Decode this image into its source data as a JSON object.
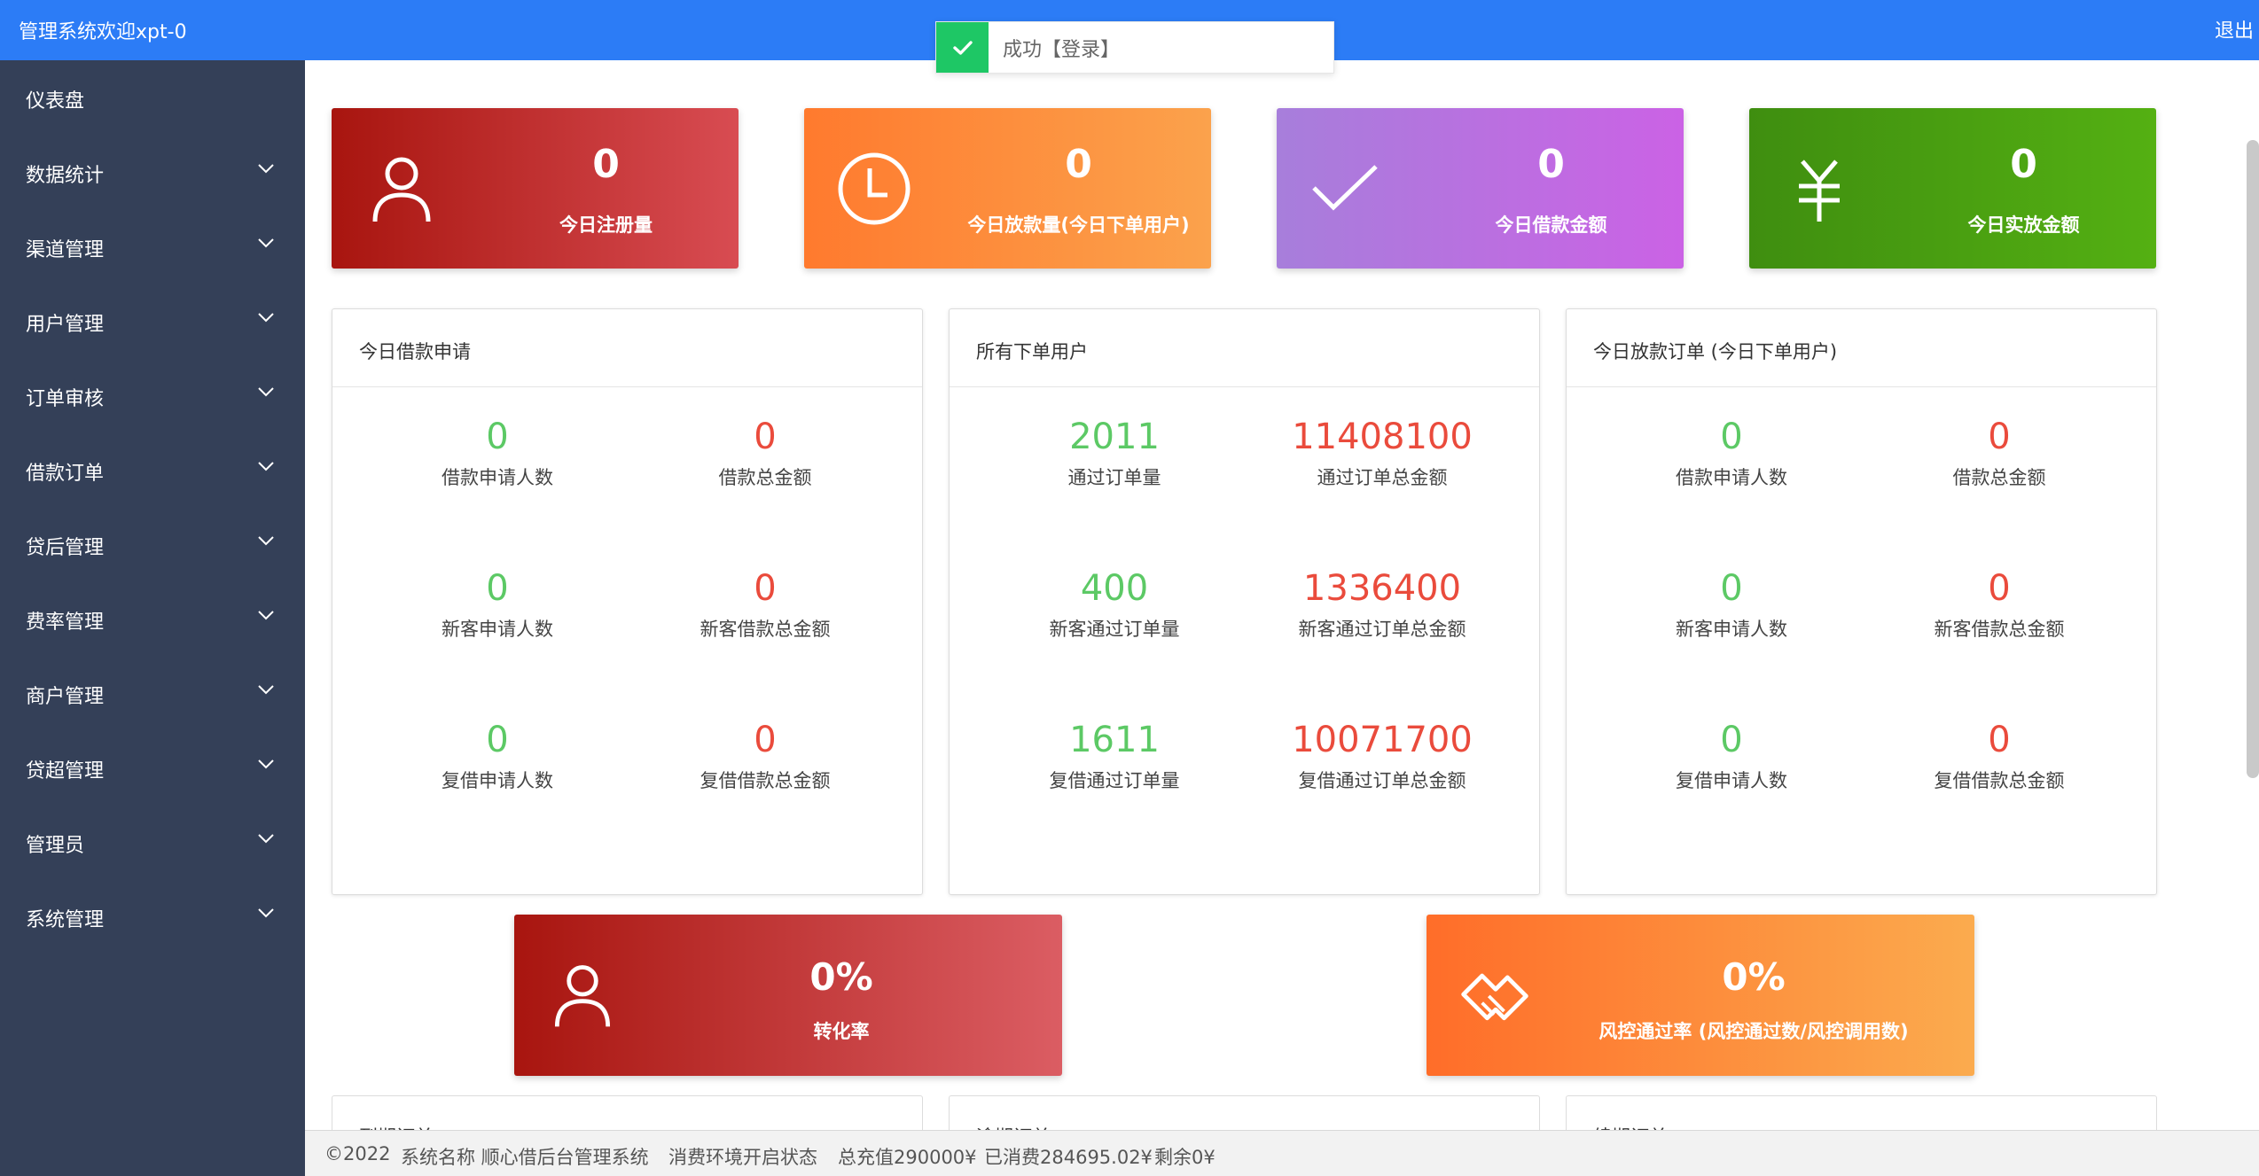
{
  "header": {
    "brand": "管理系统",
    "welcome": "欢迎xpt-0",
    "logout": "退出"
  },
  "toast": {
    "message": "成功【登录】",
    "icon": "check-icon"
  },
  "sidebar": {
    "items": [
      {
        "label": "仪表盘",
        "expandable": false
      },
      {
        "label": "数据统计",
        "expandable": true
      },
      {
        "label": "渠道管理",
        "expandable": true
      },
      {
        "label": "用户管理",
        "expandable": true
      },
      {
        "label": "订单审核",
        "expandable": true
      },
      {
        "label": "借款订单",
        "expandable": true
      },
      {
        "label": "贷后管理",
        "expandable": true
      },
      {
        "label": "费率管理",
        "expandable": true
      },
      {
        "label": "商户管理",
        "expandable": true
      },
      {
        "label": "贷超管理",
        "expandable": true
      },
      {
        "label": "管理员",
        "expandable": true
      },
      {
        "label": "系统管理",
        "expandable": true
      }
    ]
  },
  "stat_cards": [
    {
      "value": "0",
      "label": "今日注册量",
      "icon": "user-icon",
      "color": "#a8150f"
    },
    {
      "value": "0",
      "label": "今日放款量(今日下单用户)",
      "icon": "clock-icon",
      "color": "#ff7a2e"
    },
    {
      "value": "0",
      "label": "今日借款金额",
      "icon": "check-icon",
      "color": "#a77edb"
    },
    {
      "value": "0",
      "label": "今日实放金额",
      "icon": "yen-icon",
      "color": "#3f8e10"
    }
  ],
  "panels": [
    {
      "title": "今日借款申请",
      "metrics": [
        {
          "value": "0",
          "label": "借款申请人数"
        },
        {
          "value": "0",
          "label": "借款总金额"
        },
        {
          "value": "0",
          "label": "新客申请人数"
        },
        {
          "value": "0",
          "label": "新客借款总金额"
        },
        {
          "value": "0",
          "label": "复借申请人数"
        },
        {
          "value": "0",
          "label": "复借借款总金额"
        }
      ]
    },
    {
      "title": "所有下单用户",
      "metrics": [
        {
          "value": "2011",
          "label": "通过订单量"
        },
        {
          "value": "11408100",
          "label": "通过订单总金额"
        },
        {
          "value": "400",
          "label": "新客通过订单量"
        },
        {
          "value": "1336400",
          "label": "新客通过订单总金额"
        },
        {
          "value": "1611",
          "label": "复借通过订单量"
        },
        {
          "value": "10071700",
          "label": "复借通过订单总金额"
        }
      ]
    },
    {
      "title": "今日放款订单 (今日下单用户)",
      "metrics": [
        {
          "value": "0",
          "label": "借款申请人数"
        },
        {
          "value": "0",
          "label": "借款总金额"
        },
        {
          "value": "0",
          "label": "新客申请人数"
        },
        {
          "value": "0",
          "label": "新客借款总金额"
        },
        {
          "value": "0",
          "label": "复借申请人数"
        },
        {
          "value": "0",
          "label": "复借借款总金额"
        }
      ]
    }
  ],
  "rate_cards": [
    {
      "value": "0%",
      "label": "转化率",
      "icon": "user-icon",
      "color": "#a8150f"
    },
    {
      "value": "0%",
      "label": "风控通过率 (风控通过数/风控调用数)",
      "icon": "handshake-icon",
      "color": "#ff6d29"
    }
  ],
  "lower_panels": [
    {
      "title": "到期订单"
    },
    {
      "title": "逾期订单"
    },
    {
      "title": "续期订单"
    }
  ],
  "footer": {
    "copyright": "©2022",
    "system_name": "系统名称 顺心借后台管理系统",
    "env_status": "消费环境开启状态",
    "total_recharge": "总充值290000¥",
    "consumed": "已消费284695.02¥",
    "remaining": "剩余0¥"
  },
  "colors": {
    "header": "#2c7cf6",
    "sidebar": "#344058",
    "positive": "#5cc965",
    "negative": "#ea4b3c",
    "toast_success": "#1ec765"
  }
}
